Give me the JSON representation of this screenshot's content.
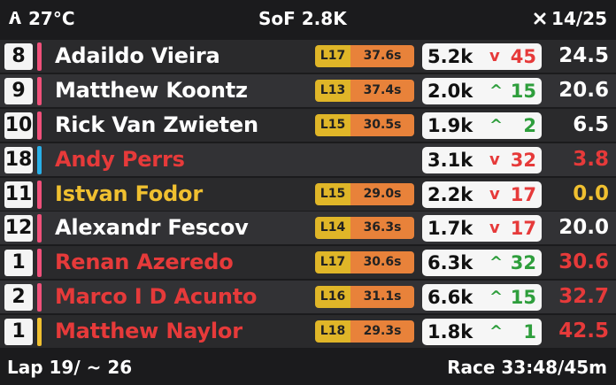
{
  "header": {
    "temp_icon": "track-icon",
    "temperature": "27°C",
    "sof": "SoF 2.8K",
    "laps_icon": "close-icon",
    "laps": "14/25"
  },
  "colors": {
    "red": "#e63a3a",
    "green": "#2e9e3c",
    "yellow": "#f0c030",
    "white": "#ffffff",
    "pink": "#f0507a",
    "blue": "#28b0e8",
    "yellow_bar": "#f0c030"
  },
  "rows": [
    {
      "pos": "8",
      "name": "Adaildo Vieira",
      "lap": "L17",
      "time": "37.6s",
      "sr": "5.2k",
      "dir": "down",
      "delta": "45",
      "gap": "24.5",
      "name_color": "white",
      "gap_color": "white",
      "bar": "pink"
    },
    {
      "pos": "9",
      "name": "Matthew Koontz",
      "lap": "L13",
      "time": "37.4s",
      "sr": "2.0k",
      "dir": "up",
      "delta": "15",
      "gap": "20.6",
      "name_color": "white",
      "gap_color": "white",
      "bar": "pink"
    },
    {
      "pos": "10",
      "name": "Rick Van Zwieten",
      "lap": "L15",
      "time": "30.5s",
      "sr": "1.9k",
      "dir": "up",
      "delta": "2",
      "gap": "6.5",
      "name_color": "white",
      "gap_color": "white",
      "bar": "pink"
    },
    {
      "pos": "18",
      "name": "Andy Perrs",
      "lap": "",
      "time": "",
      "sr": "3.1k",
      "dir": "down",
      "delta": "32",
      "gap": "3.8",
      "name_color": "red",
      "gap_color": "red",
      "bar": "blue"
    },
    {
      "pos": "11",
      "name": "Istvan Fodor",
      "lap": "L15",
      "time": "29.0s",
      "sr": "2.2k",
      "dir": "down",
      "delta": "17",
      "gap": "0.0",
      "name_color": "yellow",
      "gap_color": "yellow",
      "bar": "pink"
    },
    {
      "pos": "12",
      "name": "Alexandr Fescov",
      "lap": "L14",
      "time": "36.3s",
      "sr": "1.7k",
      "dir": "down",
      "delta": "17",
      "gap": "20.0",
      "name_color": "white",
      "gap_color": "white",
      "bar": "pink"
    },
    {
      "pos": "1",
      "name": "Renan Azeredo",
      "lap": "L17",
      "time": "30.6s",
      "sr": "6.3k",
      "dir": "up",
      "delta": "32",
      "gap": "30.6",
      "name_color": "red",
      "gap_color": "red",
      "bar": "pink"
    },
    {
      "pos": "2",
      "name": "Marco I D Acunto",
      "lap": "L16",
      "time": "31.1s",
      "sr": "6.6k",
      "dir": "up",
      "delta": "15",
      "gap": "32.7",
      "name_color": "red",
      "gap_color": "red",
      "bar": "pink"
    },
    {
      "pos": "1",
      "name": "Matthew Naylor",
      "lap": "L18",
      "time": "29.3s",
      "sr": "1.8k",
      "dir": "up",
      "delta": "1",
      "gap": "42.5",
      "name_color": "red",
      "gap_color": "red",
      "bar": "yellow_bar"
    }
  ],
  "footer": {
    "lap": "Lap 19/ ~ 26",
    "race": "Race 33:48/45m"
  }
}
